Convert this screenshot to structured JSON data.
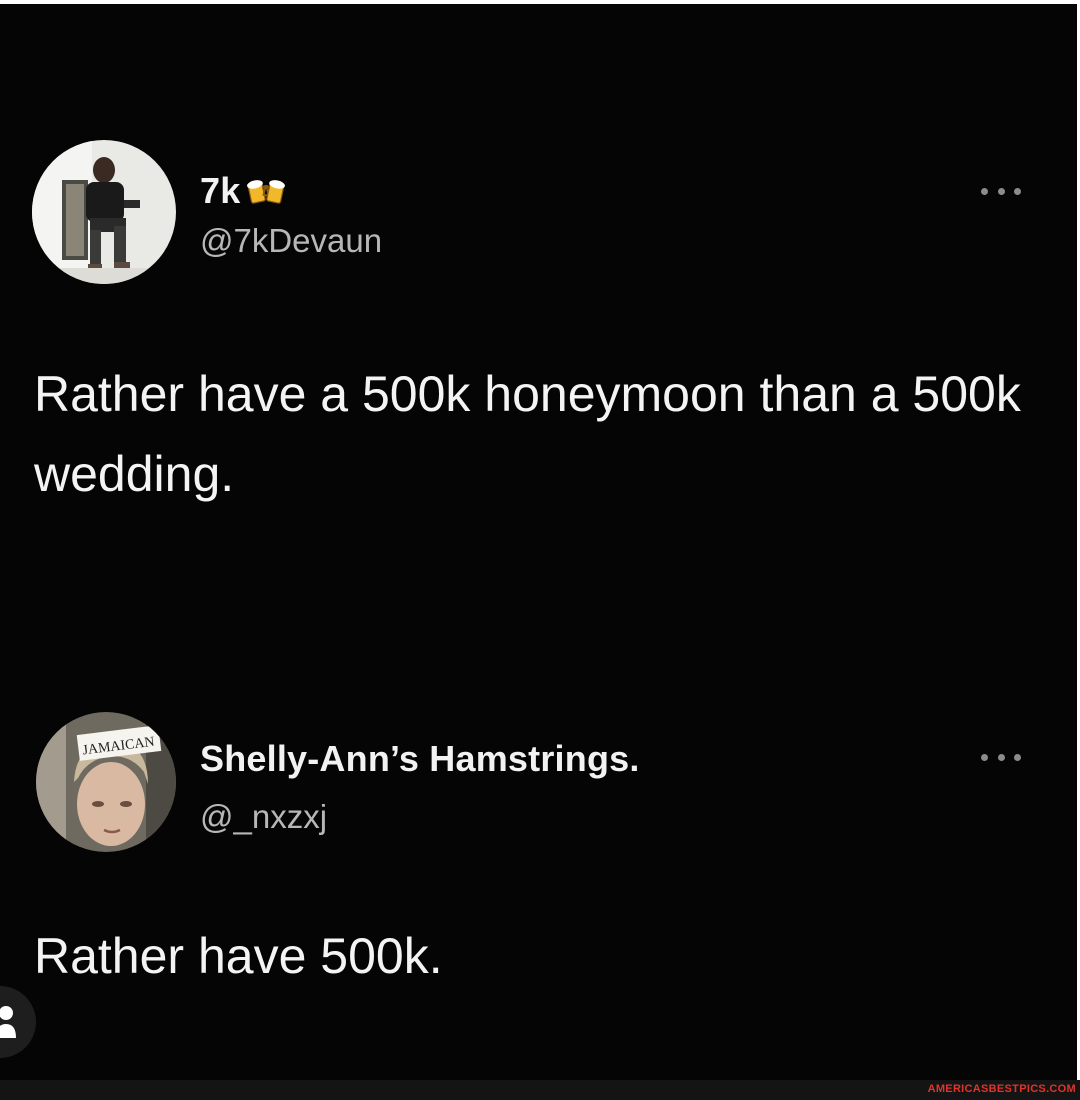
{
  "tweets": [
    {
      "display_name": "7k",
      "name_emoji": "beer-mugs-icon",
      "handle": "@7kDevaun",
      "text": "Rather have a 500k honeymoon than a 500k wedding."
    },
    {
      "display_name": "Shelly-Ann’s Hamstrings.",
      "handle": "@_nxzxj",
      "avatar_sign_text": "JAMAICAN",
      "text": "Rather have 500k."
    }
  ],
  "watermark": "AMERICASBESTPICS.COM",
  "colors": {
    "background": "#050505",
    "primary_text": "#f4f4f4",
    "secondary_text": "#b7b7b7",
    "watermark": "#e0342a"
  }
}
